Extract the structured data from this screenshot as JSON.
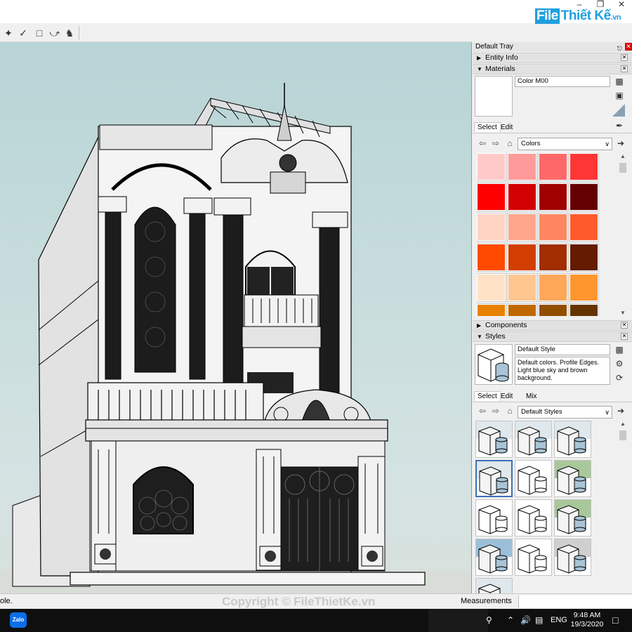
{
  "logo": {
    "box": "File",
    "text": "Thiết Kế",
    "suffix": ".vn"
  },
  "tray": {
    "title": "Default Tray",
    "sections": {
      "entity_info": "Entity Info",
      "materials": "Materials",
      "components": "Components",
      "styles": "Styles"
    }
  },
  "materials": {
    "name": "Color M00",
    "tabs": [
      "Select",
      "Edit"
    ],
    "library": "Colors",
    "swatches": [
      "#ffc9c9",
      "#ff9a9a",
      "#ff6868",
      "#ff3636",
      "#ff0000",
      "#d20000",
      "#a00000",
      "#640000",
      "#ffd3c4",
      "#ffa58c",
      "#ff8660",
      "#ff5a2c",
      "#ff4a00",
      "#d23d00",
      "#a02e00",
      "#641b00",
      "#ffe2c6",
      "#ffc690",
      "#ffa85a",
      "#ff962e",
      "#e88000",
      "#c06800",
      "#924e00",
      "#643400"
    ]
  },
  "styles": {
    "name": "Default Style",
    "description": "Default colors. Profile Edges. Light blue sky and brown background.",
    "tabs": [
      "Select",
      "Edit",
      "Mix"
    ],
    "library": "Default Styles",
    "thumbs": [
      "default",
      "default",
      "default",
      "selected",
      "sketch",
      "green",
      "sketch",
      "sketch",
      "green",
      "blue",
      "hidden",
      "gray",
      "default"
    ]
  },
  "status": {
    "text": "ole.",
    "watermark": "Copyright © FileThietKe.vn",
    "measurements_label": "Measurements"
  },
  "taskbar": {
    "zalo": "Zalo",
    "lang": "ENG",
    "time": "9:48 AM",
    "date": "19/3/2020"
  }
}
